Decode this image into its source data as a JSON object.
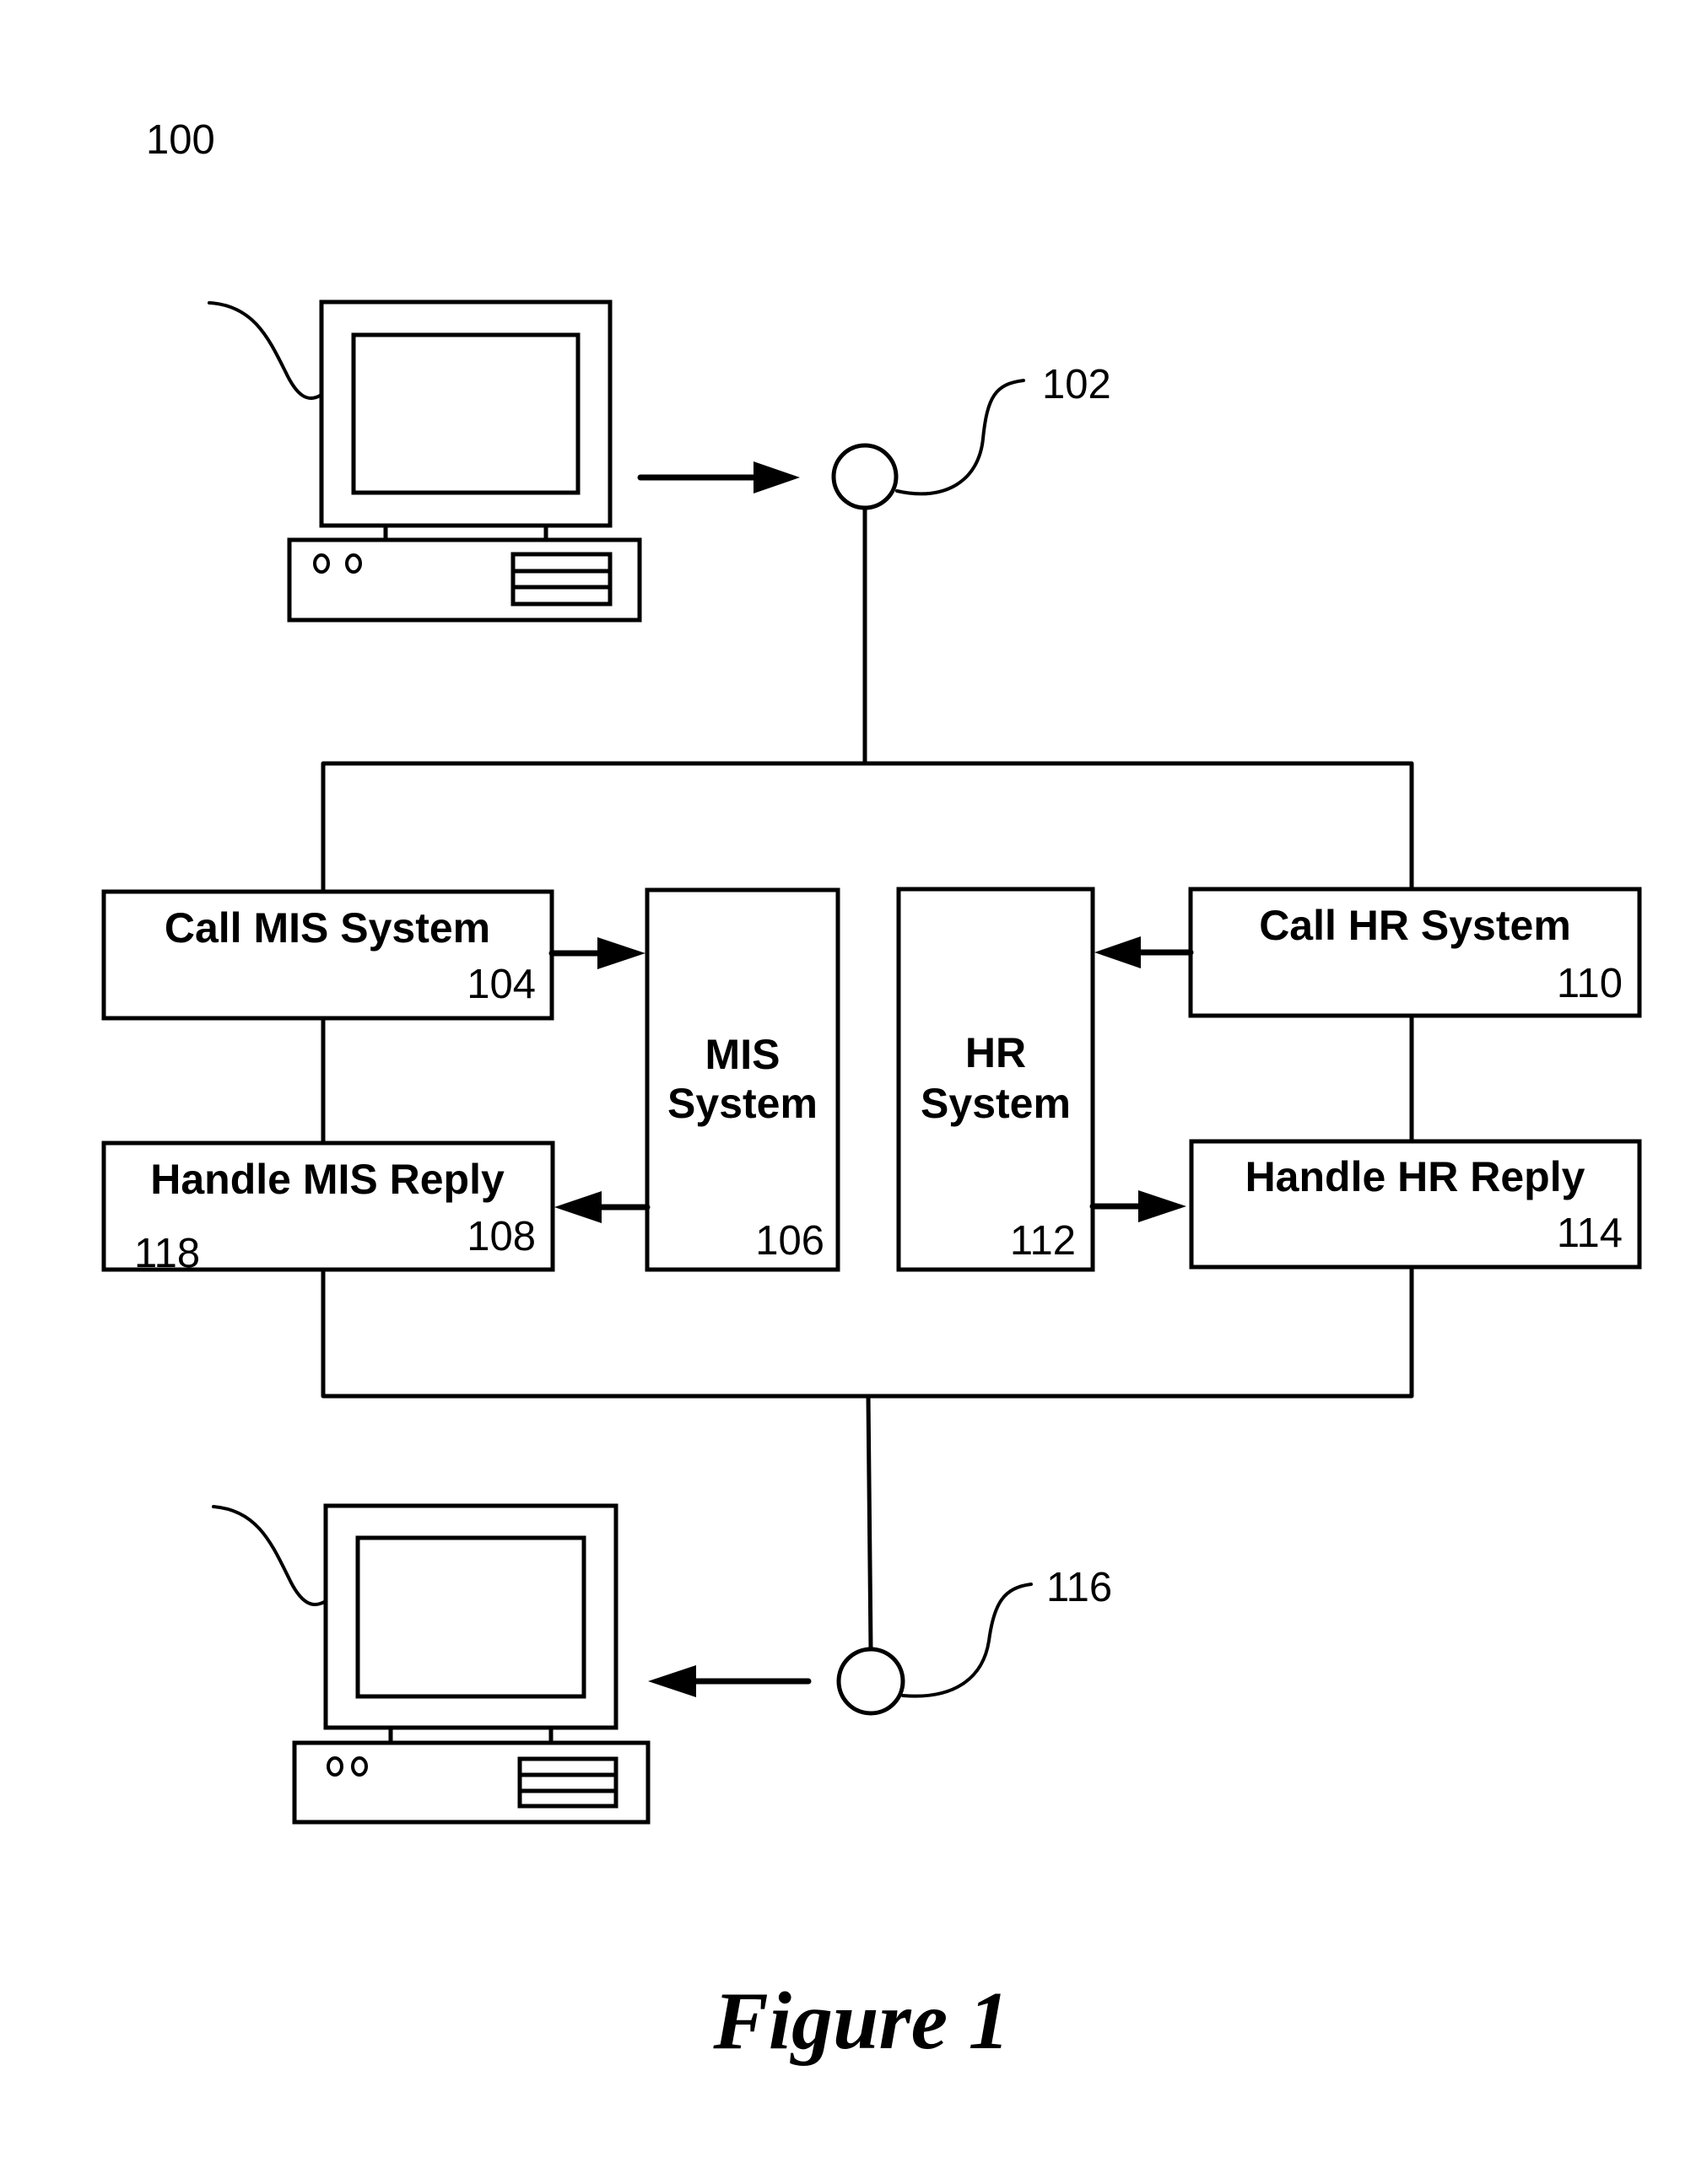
{
  "figure": {
    "reference": "100",
    "caption": "Figure 1"
  },
  "input_terminal": {
    "reference": "",
    "type": "computer-icon"
  },
  "input_node": {
    "reference": "102",
    "type": "connector-node"
  },
  "output_terminal": {
    "reference": "",
    "type": "computer-icon"
  },
  "output_node": {
    "reference": "116",
    "type": "connector-node"
  },
  "server": {
    "reference": "118",
    "components": {
      "call_mis": {
        "label": "Call MIS System",
        "reference": "104"
      },
      "mis_system": {
        "label_line1": "MIS",
        "label_line2": "System",
        "reference": "106"
      },
      "handle_mis": {
        "label": "Handle MIS Reply",
        "reference": "108"
      },
      "call_hr": {
        "label": "Call HR System",
        "reference": "110"
      },
      "hr_system": {
        "label_line1": "HR",
        "label_line2": "System",
        "reference": "112"
      },
      "handle_hr": {
        "label": "Handle HR Reply",
        "reference": "114"
      }
    }
  },
  "connections": [
    {
      "from": "input_terminal",
      "to": "input_node",
      "direction": "right"
    },
    {
      "from": "input_node",
      "to": "server",
      "direction": "down"
    },
    {
      "from": "call_mis",
      "to": "mis_system",
      "direction": "right"
    },
    {
      "from": "mis_system",
      "to": "handle_mis",
      "direction": "left"
    },
    {
      "from": "call_hr",
      "to": "hr_system",
      "direction": "left"
    },
    {
      "from": "hr_system",
      "to": "handle_hr",
      "direction": "right"
    },
    {
      "from": "server",
      "to": "output_node",
      "direction": "down"
    },
    {
      "from": "output_node",
      "to": "output_terminal",
      "direction": "left"
    }
  ]
}
